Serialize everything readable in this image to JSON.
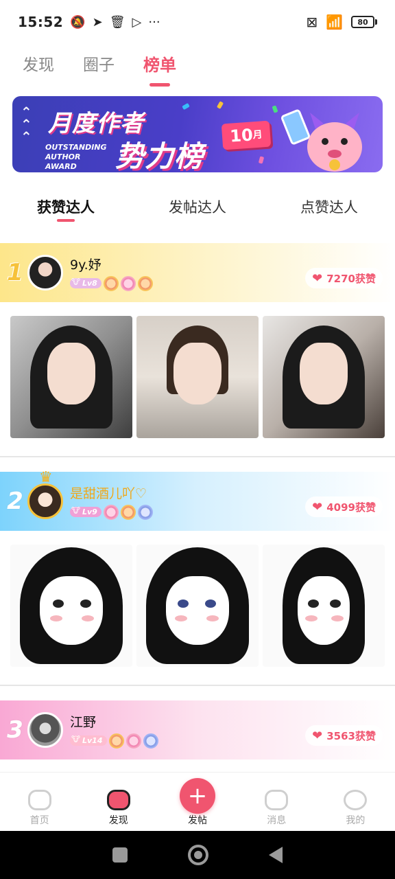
{
  "status_bar": {
    "time": "15:52",
    "left_icons": [
      "mute-icon",
      "telegram-icon",
      "trash-icon",
      "play-icon"
    ],
    "more": "···",
    "battery": "80"
  },
  "top_tabs": [
    {
      "label": "发现",
      "active": false
    },
    {
      "label": "圈子",
      "active": false
    },
    {
      "label": "榜单",
      "active": true
    }
  ],
  "banner": {
    "line1": "月度作者",
    "line2": "势力榜",
    "english": "OUTSTANDING AUTHOR AWARD",
    "month_num": "10",
    "month_unit": "月"
  },
  "sub_tabs": [
    {
      "label": "获赞达人",
      "active": true
    },
    {
      "label": "发帖达人",
      "active": false
    },
    {
      "label": "点赞达人",
      "active": false
    }
  ],
  "ranks": [
    {
      "rank": "1",
      "name": "9y.妤",
      "level": "Lv8",
      "likes": "7270获赞"
    },
    {
      "rank": "2",
      "name": "是甜酒儿吖♡",
      "level": "Lv9",
      "likes": "4099获赞"
    },
    {
      "rank": "3",
      "name": "江野",
      "level": "Lv14",
      "likes": "3563获赞"
    }
  ],
  "bottom_nav": [
    {
      "label": "首页",
      "icon": "home-icon"
    },
    {
      "label": "发现",
      "icon": "discover-icon"
    },
    {
      "label": "发帖",
      "icon": "plus-icon"
    },
    {
      "label": "消息",
      "icon": "message-icon"
    },
    {
      "label": "我的",
      "icon": "profile-icon"
    }
  ],
  "colors": {
    "accent": "#f0556f",
    "gold": "#f6c23a",
    "banner": "#4a3ec8"
  }
}
